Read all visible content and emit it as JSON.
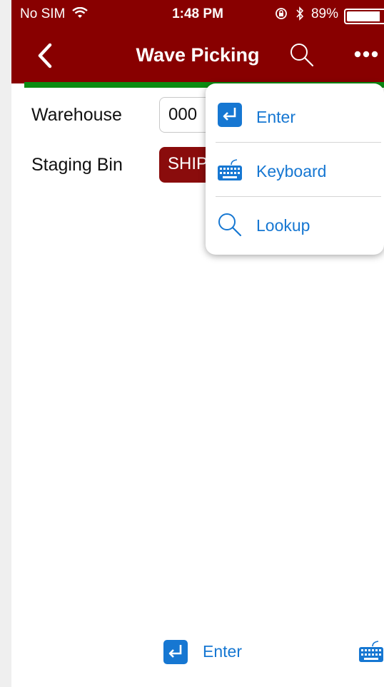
{
  "status_bar": {
    "carrier": "No SIM",
    "time": "1:48 PM",
    "battery": "89%",
    "battery_level": 0.89
  },
  "nav": {
    "title": "Wave Picking",
    "back_icon": "chevron-left-icon",
    "search_icon": "search-icon",
    "more_icon": "ellipsis-icon"
  },
  "form": {
    "warehouse_label": "Warehouse",
    "warehouse_value": "000",
    "staging_bin_label": "Staging Bin",
    "staging_bin_value": "SHIP"
  },
  "menu": {
    "items": [
      {
        "label": "Enter",
        "icon": "enter-icon"
      },
      {
        "label": "Keyboard",
        "icon": "keyboard-icon"
      },
      {
        "label": "Lookup",
        "icon": "search-icon"
      }
    ]
  },
  "toolbar": {
    "enter_label": "Enter"
  },
  "colors": {
    "nav_bg": "#880000",
    "accent_line": "#0b8c12",
    "link_blue": "#1677d2",
    "bin_field_bg": "#8a0c0c"
  }
}
